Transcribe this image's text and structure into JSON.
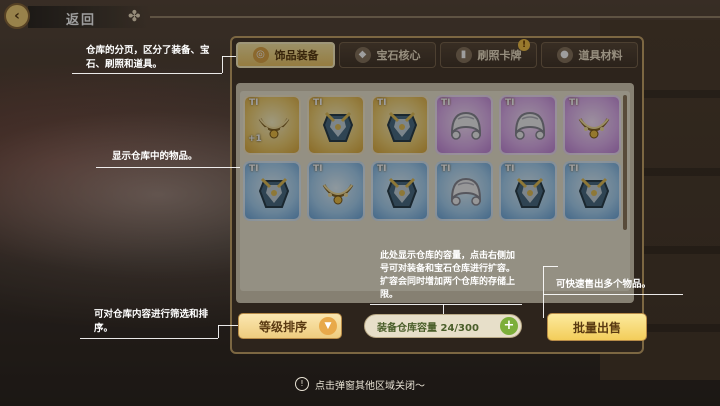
{
  "topbar": {
    "back_label": "返回"
  },
  "tabs": [
    {
      "label": "饰品装备",
      "icon": "ring-icon",
      "active": true
    },
    {
      "label": "宝石核心",
      "icon": "gem-icon",
      "active": false
    },
    {
      "label": "刷照卡牌",
      "icon": "card-icon",
      "active": false,
      "badge": "!"
    },
    {
      "label": "道具材料",
      "icon": "pouch-icon",
      "active": false
    }
  ],
  "items": [
    {
      "tier": "TI",
      "rarity": "gold",
      "kind": "necklace",
      "plus": "+1"
    },
    {
      "tier": "TI",
      "rarity": "gold",
      "kind": "armor",
      "plus": ""
    },
    {
      "tier": "TI",
      "rarity": "gold",
      "kind": "armor",
      "plus": ""
    },
    {
      "tier": "TI",
      "rarity": "purple",
      "kind": "wig",
      "plus": ""
    },
    {
      "tier": "TI",
      "rarity": "purple",
      "kind": "wig",
      "plus": ""
    },
    {
      "tier": "TI",
      "rarity": "purple",
      "kind": "necklace",
      "plus": ""
    },
    {
      "tier": "TI",
      "rarity": "blue",
      "kind": "armor",
      "plus": ""
    },
    {
      "tier": "TI",
      "rarity": "blue",
      "kind": "necklace",
      "plus": ""
    },
    {
      "tier": "TI",
      "rarity": "blue",
      "kind": "armor",
      "plus": ""
    },
    {
      "tier": "TI",
      "rarity": "blue",
      "kind": "wig",
      "plus": ""
    },
    {
      "tier": "TI",
      "rarity": "blue",
      "kind": "armor",
      "plus": ""
    },
    {
      "tier": "TI",
      "rarity": "blue",
      "kind": "armor",
      "plus": ""
    }
  ],
  "controls": {
    "sort_label": "等级排序",
    "capacity_label": "装备仓库容量 24/300",
    "sell_label": "批量出售"
  },
  "notes": {
    "tabs_note": "仓库的分页，区分了装备、宝石、刷照和道具。",
    "items_note": "显示仓库中的物品。",
    "sort_note": "可对仓库内容进行筛选和排序。",
    "capacity_note": "此处显示仓库的容量，点击右侧加号可对装备和宝石仓库进行扩容。扩容会同时增加两个仓库的存储上限。",
    "sell_note": "可快速售出多个物品。",
    "close_hint": "点击弹窗其他区域关闭～"
  },
  "colors": {
    "gold": "#f3d172",
    "purple": "#e1b2f0",
    "blue": "#a9d4f5",
    "accent": "#f1c968"
  }
}
